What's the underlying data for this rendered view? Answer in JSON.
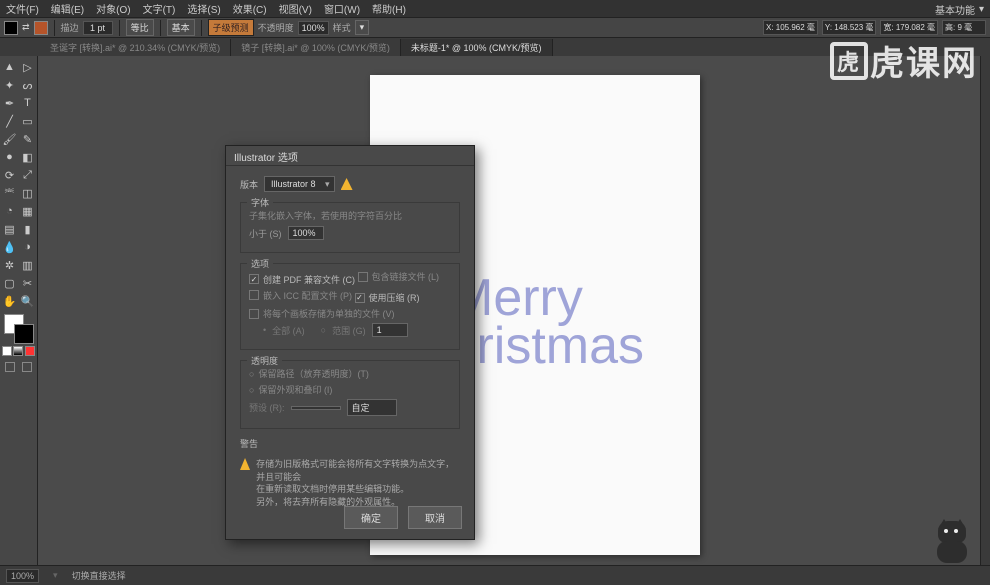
{
  "menu": {
    "items": [
      "文件(F)",
      "编辑(E)",
      "对象(O)",
      "文字(T)",
      "选择(S)",
      "效果(C)",
      "视图(V)",
      "窗口(W)",
      "帮助(H)"
    ]
  },
  "workspace_label": "基本功能",
  "options": {
    "stroke_label": "描边",
    "stroke_pt_label": "1 pt",
    "uniform": "等比",
    "basic": "基本",
    "opacity_label": "不透明度",
    "opacity_val": "100%",
    "style_label": "样式",
    "orange_label": "子级预测",
    "x": "X: 105.962 毫",
    "y": "Y: 148.523 毫",
    "w": "宽: 179.082 毫",
    "h": "高: 9 毫"
  },
  "tabs": [
    {
      "label": "圣诞字 [转换].ai* @ 210.34% (CMYK/预览)",
      "active": false
    },
    {
      "label": "镜子 [转换].ai* @ 100% (CMYK/预览)",
      "active": false
    },
    {
      "label": "未标题-1* @ 100% (CMYK/预览)",
      "active": true
    }
  ],
  "artboard": {
    "line1": "Merry",
    "line2": "Christmas"
  },
  "dialog": {
    "title": "Illustrator 选项",
    "version_label": "版本",
    "version_value": "Illustrator 8",
    "fonts_section": "字体",
    "fonts_line": "子集化嵌入字体，若使用的字符百分比",
    "fonts_lt": "小于 (S)",
    "fonts_val": "100%",
    "opts_section": "选项",
    "chk_pdf": "创建 PDF 兼容文件 (C)",
    "chk_link": "包含链接文件 (L)",
    "chk_icc": "嵌入 ICC 配置文件 (P)",
    "chk_compress": "使用压缩 (R)",
    "chk_split": "将每个画板存储为单独的文件 (V)",
    "radio_all": "全部 (A)",
    "radio_range": "范围 (G)",
    "range_val": "1",
    "trans_section": "透明度",
    "trans_opt1": "保留路径（放弃透明度）(T)",
    "trans_opt2": "保留外观和叠印 (I)",
    "preset_label": "预设 (R):",
    "preset_custom": "自定",
    "warn_section": "警告",
    "warn_text1": "存储为旧版格式可能会将所有文字转换为点文字，并且可能会",
    "warn_text2": "在重新读取文档时停用某些编辑功能。",
    "warn_text3": "另外，将去弃所有隐藏的外观属性。",
    "ok": "确定",
    "cancel": "取消"
  },
  "status": {
    "zoom": "100%",
    "hint": "切换直接选择"
  },
  "watermark": "虎课网"
}
